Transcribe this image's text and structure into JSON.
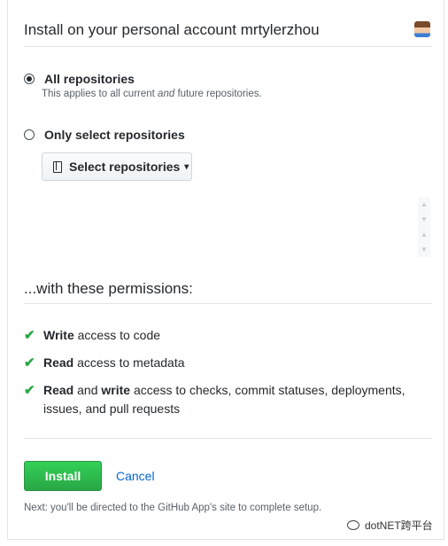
{
  "header": {
    "title": "Install on your personal account mrtylerzhou",
    "avatar_icon": "user-avatar"
  },
  "repository_access": {
    "all_label": "All repositories",
    "all_note_before": "This applies to all current",
    "all_note_emph": "and",
    "all_note_after": "future repositories.",
    "select_label": "Only select repositories",
    "selected": "all",
    "select_button_label": "Select repositories",
    "select_button_icon": "repo-icon"
  },
  "permissions": {
    "title": "...with these permissions:",
    "items": [
      {
        "bold": "Write",
        "rest": " access to code"
      },
      {
        "bold": "Read",
        "rest": " access to metadata"
      },
      {
        "bold": "Read",
        "mid": " and ",
        "bold2": "write",
        "rest": " access to checks, commit statuses, deployments, issues, and pull requests"
      }
    ]
  },
  "actions": {
    "install_label": "Install",
    "cancel_label": "Cancel",
    "next_note": "Next: you'll be directed to the GitHub App's site to complete setup."
  },
  "watermark": {
    "text": "dotNET跨平台"
  },
  "colors": {
    "accent_green": "#28a745",
    "link_blue": "#0366d6",
    "text": "#24292e",
    "muted": "#586069"
  }
}
